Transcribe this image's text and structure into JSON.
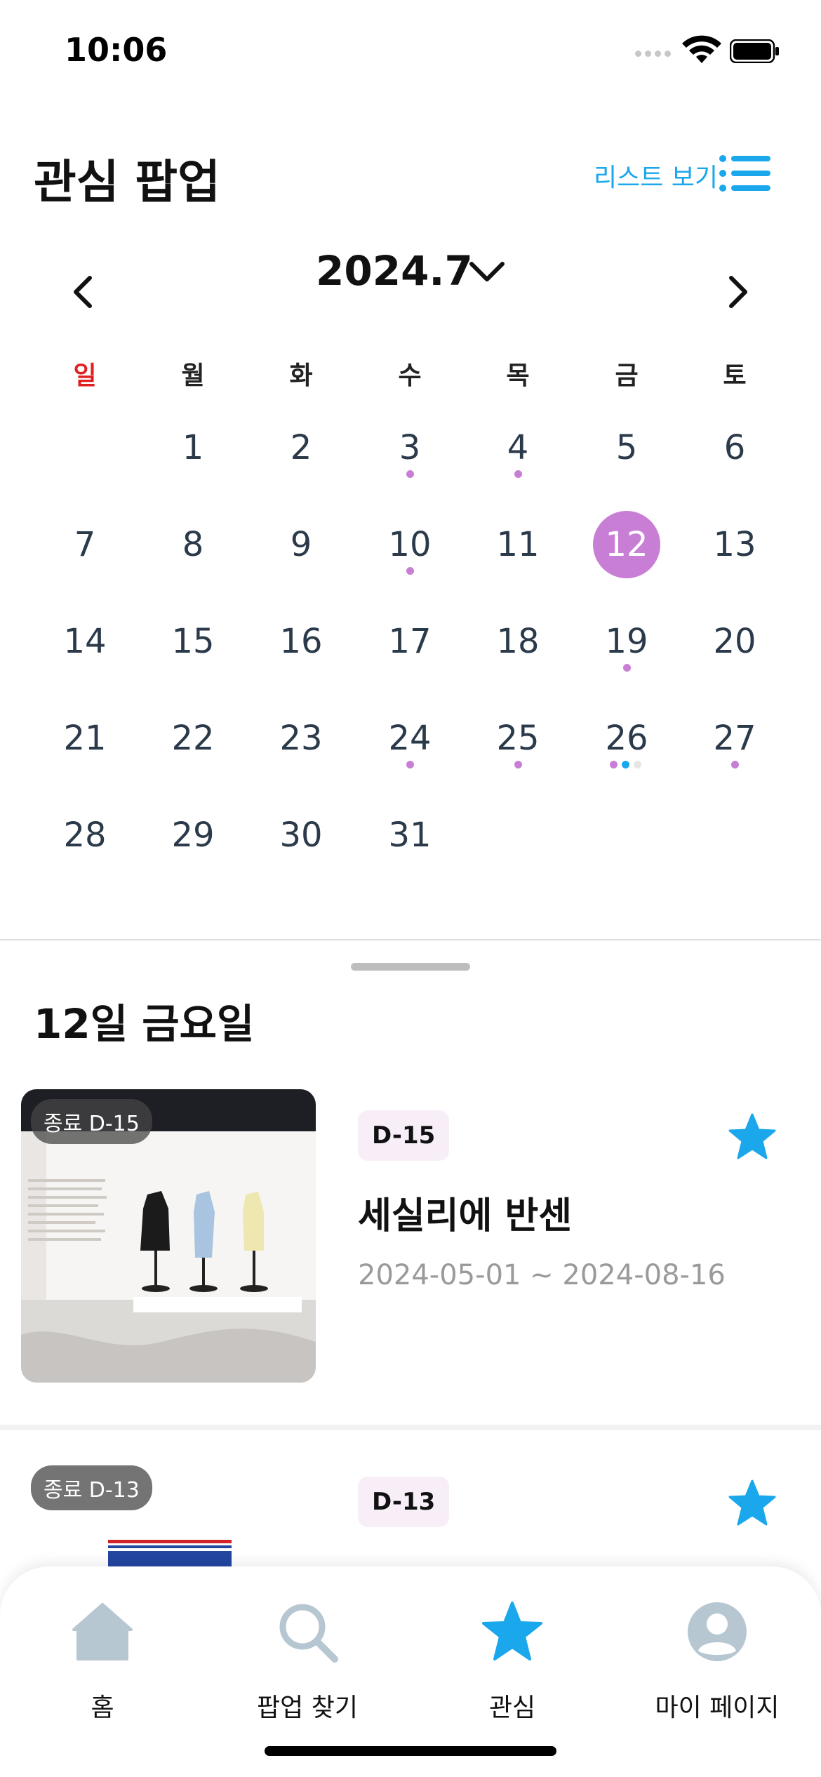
{
  "status_bar": {
    "time": "10:06"
  },
  "header": {
    "title": "관심 팝업",
    "list_view_label": "리스트 보기"
  },
  "calendar": {
    "month_label": "2024.7",
    "weekdays": [
      "일",
      "월",
      "화",
      "수",
      "목",
      "금",
      "토"
    ],
    "days": [
      "1",
      "2",
      "3",
      "4",
      "5",
      "6",
      "7",
      "8",
      "9",
      "10",
      "11",
      "12",
      "13",
      "14",
      "15",
      "16",
      "17",
      "18",
      "19",
      "20",
      "21",
      "22",
      "23",
      "24",
      "25",
      "26",
      "27",
      "28",
      "29",
      "30",
      "31"
    ],
    "selected_day": "12",
    "accent_color": "#c97ed6",
    "secondary_dot_color": "#1aa7ec"
  },
  "sheet": {
    "date_heading": "12일 금요일"
  },
  "cards": [
    {
      "end_badge": "종료 D-15",
      "dday": "D-15",
      "title": "세실리에 반센",
      "dates": "2024-05-01 ~ 2024-08-16",
      "favorite": true
    },
    {
      "end_badge": "종료 D-13",
      "dday": "D-13",
      "title": "",
      "dates": "",
      "favorite": true
    }
  ],
  "tabbar": {
    "tabs": [
      {
        "label": "홈",
        "icon": "home-icon"
      },
      {
        "label": "팝업 찾기",
        "icon": "search-icon"
      },
      {
        "label": "관심",
        "icon": "star-icon",
        "active": true
      },
      {
        "label": "마이 페이지",
        "icon": "person-icon"
      }
    ],
    "active_color": "#1aa7ec",
    "inactive_color": "#b6c7d1"
  }
}
